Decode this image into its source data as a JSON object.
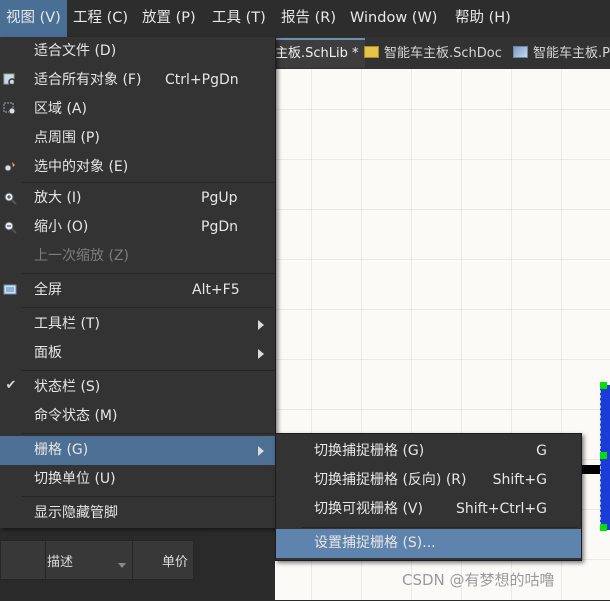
{
  "menubar": {
    "items": [
      {
        "label": "视图 (V)"
      },
      {
        "label": "工程 (C)"
      },
      {
        "label": "放置 (P)"
      },
      {
        "label": "工具 (T)"
      },
      {
        "label": "报告 (R)"
      },
      {
        "label": "Window (W)"
      },
      {
        "label": "帮助 (H)"
      }
    ]
  },
  "tabs": [
    {
      "label": "主板.SchLib *",
      "icon": "schlib-icon"
    },
    {
      "label": "智能车主板.SchDoc",
      "icon": "schdoc-icon"
    },
    {
      "label": "智能车主板.P",
      "icon": "pcb-icon"
    }
  ],
  "view_menu": {
    "items": [
      {
        "label": "适合文件 (D)",
        "shortcut": "",
        "icon": ""
      },
      {
        "label": "适合所有对象 (F)",
        "shortcut": "Ctrl+PgDn",
        "icon": "fit-all-icon"
      },
      {
        "label": "区域 (A)",
        "shortcut": "",
        "icon": "zoom-area-icon"
      },
      {
        "label": "点周围 (P)",
        "shortcut": "",
        "icon": ""
      },
      {
        "label": "选中的对象 (E)",
        "shortcut": "",
        "icon": "zoom-selected-icon"
      },
      {
        "label": "放大 (I)",
        "shortcut": "PgUp",
        "icon": "zoom-in-icon"
      },
      {
        "label": "缩小 (O)",
        "shortcut": "PgDn",
        "icon": "zoom-out-icon"
      },
      {
        "label": "上一次缩放 (Z)",
        "shortcut": "",
        "icon": "",
        "disabled": true
      },
      {
        "label": "全屏",
        "shortcut": "Alt+F5",
        "icon": "fullscreen-icon"
      },
      {
        "label": "工具栏 (T)",
        "shortcut": "",
        "submenu": true
      },
      {
        "label": "面板",
        "shortcut": "",
        "submenu": true
      },
      {
        "label": "状态栏 (S)",
        "shortcut": "",
        "checked": true
      },
      {
        "label": "命令状态 (M)",
        "shortcut": ""
      },
      {
        "label": "栅格 (G)",
        "shortcut": "",
        "submenu": true,
        "highlighted": true
      },
      {
        "label": "切换单位 (U)",
        "shortcut": ""
      },
      {
        "label": "显示隐藏管脚",
        "shortcut": ""
      }
    ]
  },
  "grid_submenu": {
    "items": [
      {
        "label": "切换捕捉栅格 (G)",
        "shortcut": "G"
      },
      {
        "label": "切换捕捉栅格 (反向) (R)",
        "shortcut": "Shift+G"
      },
      {
        "label": "切换可视栅格 (V)",
        "shortcut": "Shift+Ctrl+G"
      },
      {
        "label": "设置捕捉栅格 (S)...",
        "shortcut": "",
        "highlighted": true
      }
    ]
  },
  "bottom_panel": {
    "columns": [
      "描述",
      "单价"
    ]
  },
  "watermark": "CSDN @有梦想的咕噜",
  "colors": {
    "menu_bg": "#333333",
    "highlight": "#4d6f93",
    "submenu_highlight": "#5e83ad",
    "canvas_bg": "#fbfaf6",
    "component_blue": "#1b3cd8",
    "pin_green": "#00e000"
  }
}
